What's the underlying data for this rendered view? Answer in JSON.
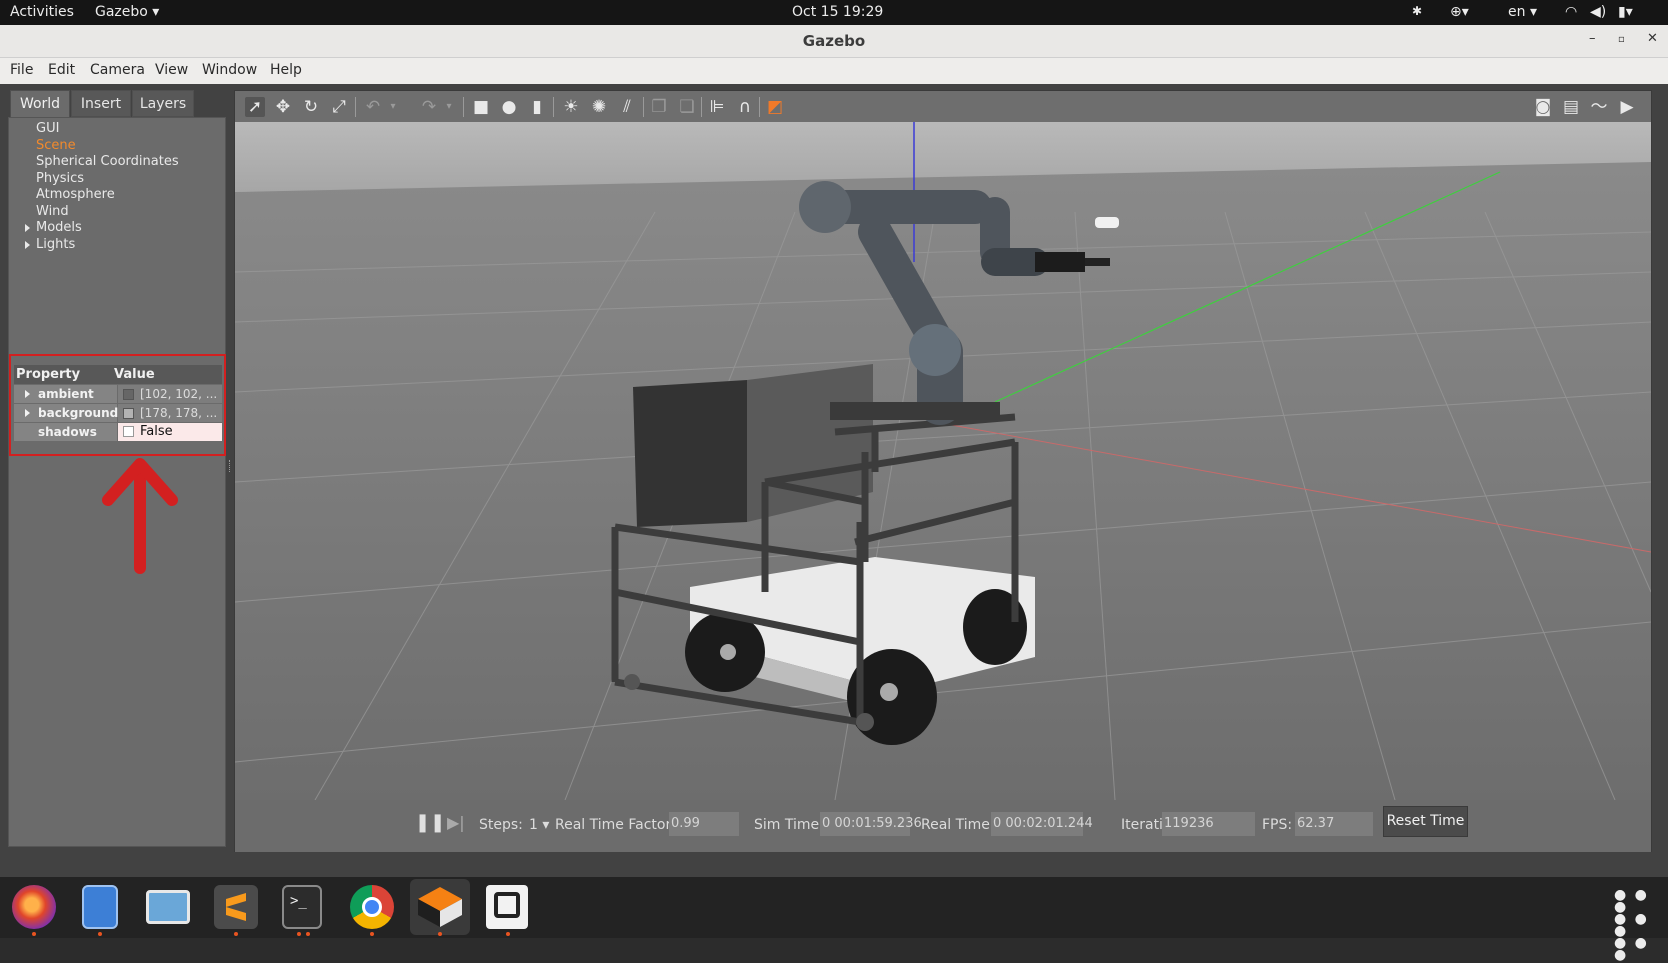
{
  "topbar": {
    "activities": "Activities",
    "app_menu": "Gazebo",
    "clock": "Oct 15  19:29",
    "lang": "en"
  },
  "window": {
    "title": "Gazebo"
  },
  "menubar": {
    "items": [
      "File",
      "Edit",
      "Camera",
      "View",
      "Window",
      "Help"
    ]
  },
  "left_panel": {
    "tabs": [
      "World",
      "Insert",
      "Layers"
    ],
    "active_tab": "World",
    "tree": [
      {
        "label": "GUI",
        "expandable": false
      },
      {
        "label": "Scene",
        "expandable": false,
        "selected": true
      },
      {
        "label": "Spherical Coordinates",
        "expandable": false
      },
      {
        "label": "Physics",
        "expandable": false
      },
      {
        "label": "Atmosphere",
        "expandable": false
      },
      {
        "label": "Wind",
        "expandable": false
      },
      {
        "label": "Models",
        "expandable": true
      },
      {
        "label": "Lights",
        "expandable": true
      }
    ],
    "properties": {
      "header_property": "Property",
      "header_value": "Value",
      "rows": [
        {
          "name": "ambient",
          "value": "[102, 102, ...",
          "swatch": "#666666"
        },
        {
          "name": "background",
          "value": "[178, 178, ...",
          "swatch": "#b2b2b2"
        },
        {
          "name": "shadows",
          "value": "False"
        }
      ]
    }
  },
  "statusbar": {
    "steps_label": "Steps:",
    "steps_value": "1",
    "rtf_label": "Real Time Factor:",
    "rtf_value": "0.99",
    "sim_time_label": "Sim Time:",
    "sim_time_value": "0 00:01:59.236",
    "real_time_label": "Real Time:",
    "real_time_value": "0 00:02:01.244",
    "iterations_label": "Iterations:",
    "iterations_value": "119236",
    "fps_label": "FPS:",
    "fps_value": "62.37",
    "reset_label": "Reset Time"
  },
  "colors": {
    "selected_tree_item": "#f28a2c",
    "annotation_red": "#d32020",
    "ubuntu_orange": "#e95420"
  }
}
